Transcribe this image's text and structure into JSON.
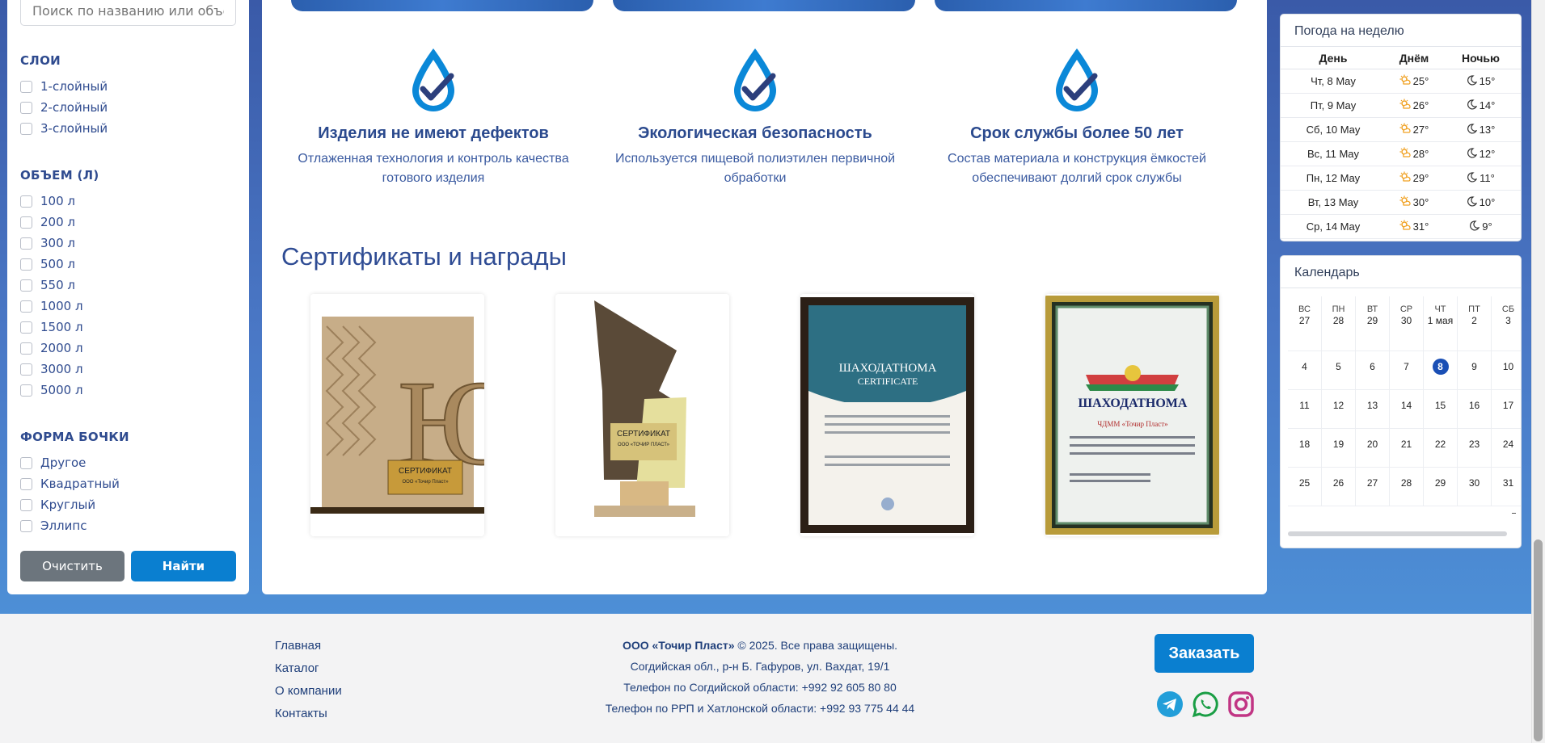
{
  "filters": {
    "search_placeholder": "Поиск по названию или объему",
    "layers_title": "СЛОИ",
    "layers": [
      "1-слойный",
      "2-слойный",
      "3-слойный"
    ],
    "volume_title": "ОБЪЕМ (Л)",
    "volumes": [
      "100 л",
      "200 л",
      "300 л",
      "500 л",
      "550 л",
      "1000 л",
      "1500 л",
      "2000 л",
      "3000 л",
      "5000 л"
    ],
    "shape_title": "ФОРМА БОЧКИ",
    "shapes": [
      "Другое",
      "Квадратный",
      "Круглый",
      "Эллипс"
    ],
    "clear_label": "Очистить",
    "find_label": "Найти"
  },
  "features": [
    {
      "title": "Изделия не имеют дефектов",
      "text": "Отлаженная технология и контроль качества готового изделия"
    },
    {
      "title": "Экологическая безопасность",
      "text": "Используется пищевой полиэтилен первичной обработки"
    },
    {
      "title": "Срок службы более 50 лет",
      "text": "Состав материала и конструкция ёмкостей обеспечивают долгий срок службы"
    }
  ],
  "certificates": {
    "title": "Сертификаты и награды",
    "items": [
      {
        "caption": "СЕРТИФИКАТ",
        "sub": "ООО «Точир Пласт»"
      },
      {
        "caption": "СЕРТИФИКАТ",
        "sub": "ООО «ТОЧИР ПЛАСТ»"
      },
      {
        "caption": "ШАХОДАТНОМА",
        "sub": "CERTIFICATE"
      },
      {
        "caption": "ШАХОДАТНОМА",
        "sub": "ЧДММ «Точир Пласт»"
      }
    ]
  },
  "weather": {
    "title": "Погода на неделю",
    "col_day": "День",
    "col_daytime": "Днём",
    "col_night": "Ночью",
    "rows": [
      {
        "day": "Чт, 8 May",
        "d": "25°",
        "n": "15°"
      },
      {
        "day": "Пт, 9 May",
        "d": "26°",
        "n": "14°"
      },
      {
        "day": "Сб, 10 May",
        "d": "27°",
        "n": "13°"
      },
      {
        "day": "Вс, 11 May",
        "d": "28°",
        "n": "12°"
      },
      {
        "day": "Пн, 12 May",
        "d": "29°",
        "n": "11°"
      },
      {
        "day": "Вт, 13 May",
        "d": "30°",
        "n": "10°"
      },
      {
        "day": "Ср, 14 May",
        "d": "31°",
        "n": "9°"
      }
    ]
  },
  "calendar": {
    "title": "Календарь",
    "header": [
      {
        "dow": "ВС",
        "dn": "27"
      },
      {
        "dow": "ПН",
        "dn": "28"
      },
      {
        "dow": "ВТ",
        "dn": "29"
      },
      {
        "dow": "СР",
        "dn": "30"
      },
      {
        "dow": "ЧТ",
        "dn": "1 мая"
      },
      {
        "dow": "ПТ",
        "dn": "2"
      },
      {
        "dow": "СБ",
        "dn": "3"
      }
    ],
    "weeks": [
      [
        "4",
        "5",
        "6",
        "7",
        "8",
        "9",
        "10"
      ],
      [
        "11",
        "12",
        "13",
        "14",
        "15",
        "16",
        "17"
      ],
      [
        "18",
        "19",
        "20",
        "21",
        "22",
        "23",
        "24"
      ],
      [
        "25",
        "26",
        "27",
        "28",
        "29",
        "30",
        "31"
      ]
    ],
    "today": "8"
  },
  "footer": {
    "nav": [
      "Главная",
      "Каталог",
      "О компании",
      "Контакты"
    ],
    "company": "ООО «Точир Пласт»",
    "copyright": "© 2025. Все права защищены.",
    "address": "Согдийская обл., р-н Б. Гафуров, ул. Вахдат, 19/1",
    "phone1": "Телефон по Согдийской области: +992 92 605 80 80",
    "phone2": "Телефон по РРП и Хатлонской области: +992 93 775 44 44",
    "order_label": "Заказать"
  },
  "colors": {
    "accent": "#0a7fd0",
    "heading": "#2b4a8e",
    "telegram": "#229ed9",
    "whatsapp": "#1a9e45",
    "instagram": "#c13584"
  }
}
